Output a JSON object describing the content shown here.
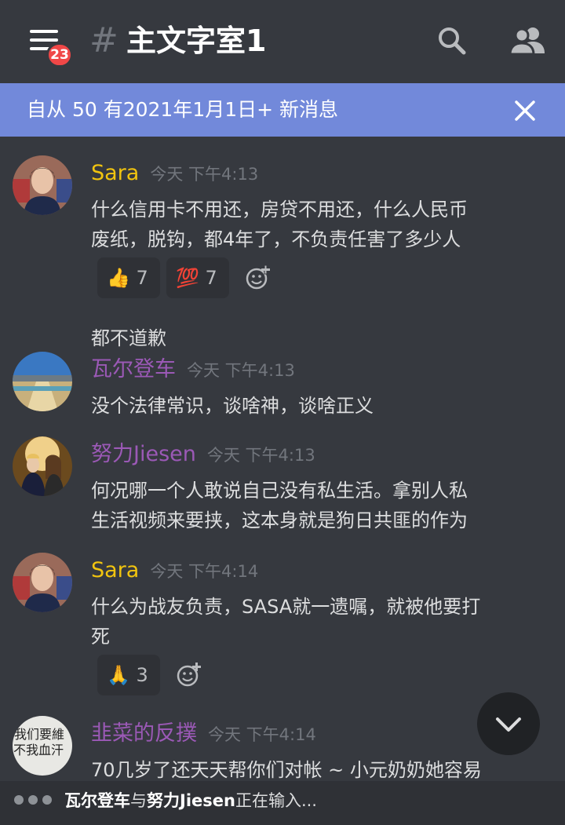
{
  "header": {
    "menu_icon": "hamburger-menu-icon",
    "badge_count": "23",
    "hash": "#",
    "channel_name": "主文字室1",
    "search_icon": "search-icon",
    "members_icon": "members-icon"
  },
  "banner": {
    "text": "自从 50 有2021年1月1日+ 新消息",
    "close_icon": "close-icon",
    "color": "#7289da"
  },
  "messages": [
    {
      "username": "Sara",
      "username_color": "#f1c40f",
      "timestamp": "今天 下午4:13",
      "lines": [
        "什么信用卡不用还，房贷不用还，什么人民币",
        "废纸，脱钩，都4年了，不负责任害了多少人"
      ],
      "reactions": [
        {
          "emoji": "👍",
          "count": "7"
        },
        {
          "emoji": "💯",
          "count": "7"
        }
      ],
      "followup": "都不道歉"
    },
    {
      "username": "瓦尔登车",
      "username_color": "#9b59b6",
      "timestamp": "今天 下午4:13",
      "lines": [
        "没个法律常识，谈啥神，谈啥正义"
      ]
    },
    {
      "username": "努力Jiesen",
      "username_color": "#9b59b6",
      "timestamp": "今天 下午4:13",
      "lines": [
        "何况哪一个人敢说自己没有私生活。拿别人私",
        "生活视频来要挟，这本身就是狗日共匪的作为"
      ]
    },
    {
      "username": "Sara",
      "username_color": "#f1c40f",
      "timestamp": "今天 下午4:14",
      "lines": [
        "什么为战友负责，SASA就一遗嘱，就被他要打",
        "死"
      ],
      "reactions": [
        {
          "emoji": "🙏",
          "count": "3"
        }
      ]
    },
    {
      "username": "韭菜的反撲",
      "username_color": "#9b59b6",
      "timestamp": "今天 下午4:14",
      "lines": [
        "70几岁了还天天帮你们对帐 ~ 小元奶奶她容易"
      ],
      "avatar_text": [
        "我们要維",
        "不我血汗"
      ]
    }
  ],
  "scroll_down_icon": "chevron-down-icon",
  "typing": {
    "user1": "瓦尔登车",
    "joiner": "与",
    "user2": "努力Jiesen",
    "suffix": "正在输入..."
  }
}
